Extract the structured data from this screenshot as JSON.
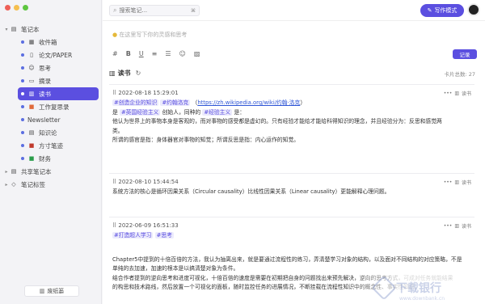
{
  "sidebar": {
    "root": "笔记本",
    "items": [
      {
        "label": "收件箱",
        "icon": "inbox-icon"
      },
      {
        "label": "论文/PAPER",
        "icon": "document-icon"
      },
      {
        "label": "思考",
        "icon": "emoji-icon"
      },
      {
        "label": "摘录",
        "icon": "excerpt-icon"
      },
      {
        "label": "读书",
        "icon": "book-icon"
      },
      {
        "label": "工作复思录",
        "icon": "notebook-icon"
      },
      {
        "label": "Newsletter",
        "icon": "newsletter-icon"
      },
      {
        "label": "知识论",
        "icon": "knowledge-icon"
      },
      {
        "label": "方寸笔迹",
        "icon": "bookmark-icon"
      },
      {
        "label": "财务",
        "icon": "money-icon"
      }
    ],
    "shared": "共享笔记本",
    "tags": "笔记标签",
    "trash": "废纸篓"
  },
  "topbar": {
    "search_placeholder": "搜索笔记...",
    "write_mode": "写作模式"
  },
  "composer": {
    "placeholder": "在这里写下你的灵感和思考",
    "record": "记录",
    "toolbar": [
      "#",
      "B",
      "U",
      "list",
      "ordered-list",
      "emoji",
      "image"
    ]
  },
  "section": {
    "title": "读书",
    "count_label": "卡片总数:",
    "count": "27"
  },
  "cards": [
    {
      "time": "2022-08-18 15:29:01",
      "notebook": "读书",
      "tags": [
        "#创造企业的知识",
        "#约翰洛克"
      ],
      "link": "https://zh.wikipedia.org/wiki/约翰·洛克",
      "line2_pre": "是",
      "line2_tag1": "#英国经验主义",
      "line2_mid": "创始人，同种的",
      "line2_tag2": "#经验主义",
      "line2_post": "是：",
      "line3": "他认为世界上的事物本身是客观的，而对事物的感受都是虚幻的。只有经验才能给才能给科得知识的理念，并且经验分为：反思和感觉两",
      "line4": "类。",
      "line5": "所谓的感官是指：身体器官对事物的知觉；所谓反思是指：内心运作的知觉。"
    },
    {
      "time": "2022-08-10 15:44:54",
      "notebook": "读书",
      "text": "系统方法的核心是循环因果关系（Circular causality）比线性因果关系（Linear causality）更能解释心理问题。"
    },
    {
      "time": "2022-06-09 16:51:33",
      "notebook": "读书",
      "tags": [
        "#打造超人学习",
        "#思考"
      ],
      "text1": "Chapter5中提到的十倍百倍的方法，我认为抽离出来，就是要通过流程性的练习，弄清楚学习对象的结构，以及面对不同结构的对应策略，不是",
      "text2": "单纯的去加速，加速的根本是以搞清楚对象为条件。",
      "text3": "结合作者提到的逆向思考和进度可视化，十倍百倍的速度是需要在初期把自身的问题找出来预先解决，逆向的思考方式，可成对任务就能结果",
      "text4": "的构思和技术路线，然后放置一个可视化的面板，随时监控任务的进展情况，不断挂载在流程性知识中的概念性、事实性知识。"
    }
  ],
  "watermark": {
    "main": "下载银行",
    "sub": "www.downbank.cn"
  }
}
